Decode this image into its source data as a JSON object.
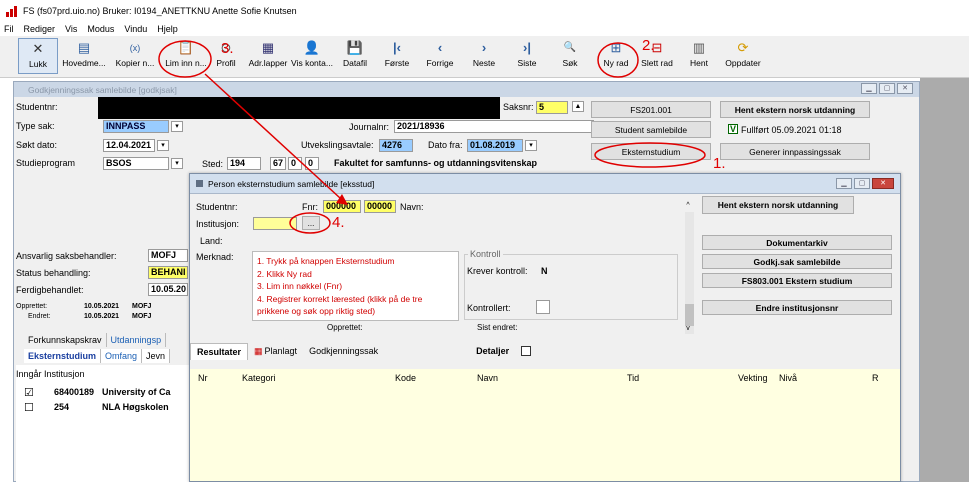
{
  "title_bar": {
    "text": "FS (fs07prd.uio.no) Bruker: I0194_ANETTKNU Anette Sofie Knutsen"
  },
  "menu": [
    "Fil",
    "Rediger",
    "Vis",
    "Modus",
    "Vindu",
    "Hjelp"
  ],
  "toolbar": [
    {
      "label": "Lukk",
      "icon": "✕"
    },
    {
      "label": "Hovedme...",
      "icon": "▤"
    },
    {
      "label": "Kopier n...",
      "icon": "(x)"
    },
    {
      "label": "Lim inn n...",
      "icon": "📋"
    },
    {
      "label": "Profil",
      "icon": "⊙"
    },
    {
      "label": "Adr.lapper",
      "icon": "▦"
    },
    {
      "label": "Vis konta...",
      "icon": "👤"
    },
    {
      "label": "Datafil",
      "icon": "💾"
    },
    {
      "label": "Første",
      "icon": "|‹"
    },
    {
      "label": "Forrige",
      "icon": "‹"
    },
    {
      "label": "Neste",
      "icon": "›"
    },
    {
      "label": "Siste",
      "icon": "›|"
    },
    {
      "label": "Søk",
      "icon": "🔍"
    },
    {
      "label": "Ny rad",
      "icon": "⊞"
    },
    {
      "label": "Slett rad",
      "icon": "⊟"
    },
    {
      "label": "Hent",
      "icon": "▥"
    },
    {
      "label": "Oppdater",
      "icon": "⟳"
    }
  ],
  "back_window": {
    "title": "Godkjenningssak samlebilde [godkjsak]",
    "studentnr_label": "Studentnr:",
    "saksnr_label": "Saksnr:",
    "saksnr_value": "5",
    "type_sak_label": "Type sak:",
    "type_sak_value": "INNPASS",
    "journalnr_label": "Journalnr:",
    "journalnr_value": "2021/18936",
    "sokt_dato_label": "Søkt dato:",
    "sokt_dato_value": "12.04.2021",
    "utveksling_label": "Utvekslingsavtale:",
    "utveksling_value": "4276",
    "dato_fra_label": "Dato fra:",
    "dato_fra_value": "01.08.2019",
    "studieprogram_label": "Studieprogram",
    "studieprogram_value": "BSOS",
    "sted_label": "Sted:",
    "sted_1": "194",
    "sted_2": "67",
    "sted_3": "0",
    "sted_4": "0",
    "fakultet": "Fakultet for samfunns- og utdanningsvitenskap",
    "btn_fs201": "FS201.001",
    "btn_hent_ekstern": "Hent ekstern norsk utdanning",
    "btn_student_samlebilde": "Student samlebilde",
    "fullfort_text": "Fullført 05.09.2021 01:18",
    "btn_eksternstudium": "Eksternstudium",
    "btn_generer": "Generer innpassingssak",
    "ansvarlig_label": "Ansvarlig saksbehandler:",
    "ansvarlig_value": "MOFJ",
    "status_label": "Status behandling:",
    "status_value": "BEHANI",
    "ferdig_label": "Ferdigbehandlet:",
    "ferdig_value": "10.05.20",
    "opprettet_label": "Opprettet:",
    "opprettet_date": "10.05.2021",
    "opprettet_user": "MOFJ",
    "endret_label": "Endret:",
    "endret_date": "10.05.2021",
    "endret_user": "MOFJ",
    "tabs1": [
      "Forkunnskapskrav",
      "Utdanningsp"
    ],
    "tabs2": [
      "Eksternstudium",
      "Omfang",
      "Jevn"
    ],
    "list_header": "Inngår Institusjon",
    "rows": [
      {
        "checked": "☑",
        "code": "68400189",
        "name": "University of Ca"
      },
      {
        "checked": "☐",
        "code": "254",
        "name": "NLA Høgskolen"
      }
    ]
  },
  "front_window": {
    "title": "Person eksternstudium samlebilde [eksstud]",
    "studentnr_label": "Studentnr:",
    "fnr_label": "Fnr:",
    "fnr_1": "000000",
    "fnr_2": "00000",
    "navn_label": "Navn:",
    "institusjon_label": "Institusjon:",
    "ellipsis": "...",
    "land_label": "Land:",
    "merknad_label": "Merknad:",
    "kontroll_label": "Kontroll",
    "krever_label": "Krever kontroll:",
    "krever_value": "N",
    "kontrollert_label": "Kontrollert:",
    "opprettet_label": "Opprettet:",
    "sist_endret_label": "Sist endret:",
    "btn_hent": "Hent ekstern norsk utdanning",
    "btn_dokumentarkiv": "Dokumentarkiv",
    "btn_godkj": "Godkj.sak samlebilde",
    "btn_fs803": "FS803.001 Ekstern studium",
    "btn_endre": "Endre institusjonsnr",
    "instructions": [
      "1. Trykk på knappen Eksternstudium",
      "2. Klikk Ny rad",
      "3. Lim inn nøkkel (Fnr)",
      "4. Registrer korrekt lærested (klikk på de tre",
      "prikkene og søk opp riktig sted)"
    ],
    "tabs": [
      "Resultater",
      "Planlagt",
      "Godkjenningssak"
    ],
    "detaljer_label": "Detaljer",
    "grid_columns": [
      "Nr",
      "Kategori",
      "Kode",
      "Navn",
      "Tid",
      "Vekting",
      "Nivå",
      "R"
    ]
  },
  "annotations": {
    "n1": "1.",
    "n2": "2.",
    "n3": "3.",
    "n4": "4."
  },
  "colors": {
    "annotation": "#e00000",
    "yellow_field": "#ffff66",
    "grid_bg": "#ffffe1"
  }
}
